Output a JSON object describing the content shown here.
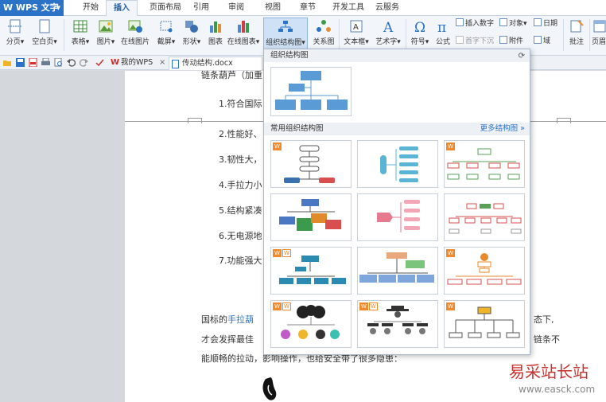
{
  "app": {
    "name": "WPS 文字"
  },
  "menu": {
    "tabs": [
      "开始",
      "插入",
      "页面布局",
      "引用",
      "审阅",
      "视图",
      "章节",
      "开发工具",
      "云服务"
    ],
    "active": "插入"
  },
  "ribbon": {
    "page_break": "分页",
    "blank_page": "空白页",
    "table": "表格",
    "picture": "图片",
    "online_picture": "在线图片",
    "screenshot": "截屏",
    "shape": "形状",
    "chart": "图表",
    "online_chart": "在线图表",
    "org_chart": "组织结构图",
    "relation_chart": "关系图",
    "textbox": "文本框",
    "wordart": "艺术字",
    "symbol": "符号",
    "formula": "公式",
    "insert_number": "插入数字",
    "object": "对象",
    "date": "日期",
    "drop_cap": "首字下沉",
    "attachment": "附件",
    "domain": "域",
    "comment": "批注",
    "page_header": "页眉"
  },
  "doc_tabs": {
    "home": "我的WPS",
    "current": "传动结构.docx"
  },
  "document": {
    "top_line": "链条葫芦（加重",
    "items": [
      "1.符合国际",
      "2.性能好、",
      "3.韧性大，",
      "4.手拉力小",
      "5.结构紧凑",
      "6.无电源地",
      "7.功能强大"
    ],
    "para1_a": "国标的",
    "para1_link": "手拉葫",
    "para1_right": "态下,",
    "para2_a": "才会发挥最佳",
    "para2_right": "链条不",
    "para3": "能顺畅的拉动，影响操作，也给安全带了很多隐患："
  },
  "panel": {
    "title": "组织结构图",
    "common_title": "常用组织结构图",
    "more_link": "更多结构图 »",
    "badge": "W"
  },
  "watermark": {
    "cn": "易采站长站",
    "url": "www.easck.com"
  },
  "colors": {
    "accent": "#2b73c6",
    "badge": "#f08a2c",
    "watermark": "#c8302c"
  }
}
